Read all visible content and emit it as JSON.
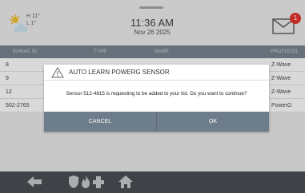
{
  "weather": {
    "icon": "partly-sunny-icon",
    "high": "H 11°",
    "low": "L 1°"
  },
  "clock": {
    "time": "11:36 AM",
    "date": "Nov 26 2025"
  },
  "messages": {
    "icon": "envelope-icon",
    "badge_count": "1"
  },
  "table": {
    "columns": [
      "ID/MAC ID",
      "TYPE",
      "NAME",
      "PROTOCOL"
    ],
    "rows": [
      {
        "id": "8",
        "protocol": "Z-Wave"
      },
      {
        "id": "9",
        "protocol": "Z-Wave"
      },
      {
        "id": "12",
        "protocol": "Z-Wave"
      },
      {
        "id": "502-2765",
        "protocol": "PowerG"
      }
    ]
  },
  "dialog": {
    "icon": "warning-icon",
    "title": "AUTO LEARN POWERG SENSOR",
    "message": "Sensor 512-4815 is requesting to be added to your list. Do you want to continue?",
    "cancel_label": "CANCEL",
    "ok_label": "OK"
  },
  "navbar": {
    "icons": [
      "back-arrow-icon",
      "shield-icon",
      "fire-icon",
      "medical-cross-icon",
      "home-icon"
    ]
  },
  "colors": {
    "header_bar": "#6c7a88",
    "dialog_buttons": "#6e7d8b",
    "badge": "#e4231b",
    "navbar": "#3a3f45"
  }
}
